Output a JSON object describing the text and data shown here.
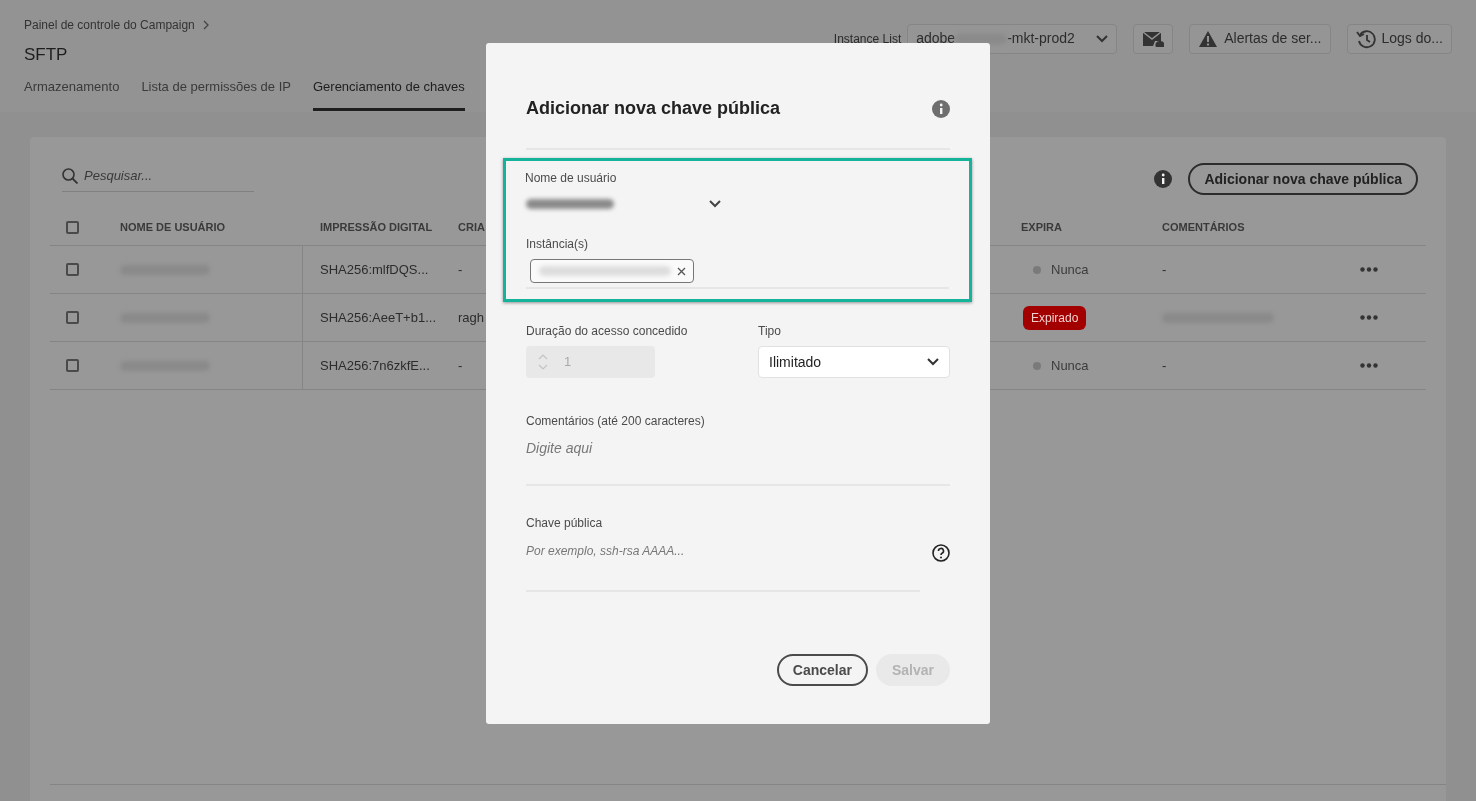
{
  "breadcrumb": "Painel de controle do Campaign",
  "page_title": "SFTP",
  "tabs": [
    {
      "label": "Armazenamento",
      "selected": false
    },
    {
      "label": "Lista de permissões de IP",
      "selected": false
    },
    {
      "label": "Gerenciamento de chaves",
      "selected": true
    }
  ],
  "toolbar": {
    "instance_label": "Instance List",
    "instance_value_start": "adobe",
    "instance_value_end": "-mkt-prod2",
    "alerts_button": "Alertas de ser...",
    "logs_button": "Logs do..."
  },
  "search": {
    "placeholder": "Pesquisar..."
  },
  "add_button": "Adicionar nova chave pública",
  "table": {
    "select_all_checked": false,
    "columns": [
      "NOME DE USUÁRIO",
      "IMPRESSÃO DIGITAL",
      "CRIA",
      "EXPIRA",
      "COMENTÁRIOS"
    ],
    "rows": [
      {
        "checked": false,
        "fingerprint": "SHA256:mlfDQS...",
        "created_by": "-",
        "expires": {
          "kind": "never",
          "text": "Nunca"
        },
        "comment": "-",
        "comment_redacted": false
      },
      {
        "checked": false,
        "fingerprint": "SHA256:AeeT+b1...",
        "created_by": "ragh",
        "expires": {
          "kind": "expired",
          "text": "Expirado"
        },
        "comment_redacted": true
      },
      {
        "checked": false,
        "fingerprint": "SHA256:7n6zkfE...",
        "created_by": "-",
        "expires": {
          "kind": "never",
          "text": "Nunca"
        },
        "comment": "-",
        "comment_redacted": false
      }
    ]
  },
  "modal": {
    "title": "Adicionar nova chave pública",
    "username_label": "Nome de usuário",
    "instances_label": "Instância(s)",
    "duration_label": "Duração do acesso concedido",
    "duration_value": "1",
    "duration_disabled": true,
    "type_label": "Tipo",
    "type_value": "Ilimitado",
    "comments_label": "Comentários (até 200 caracteres)",
    "comments_placeholder": "Digite aqui",
    "key_label": "Chave pública",
    "key_placeholder": "Por exemplo, ssh-rsa AAAA...",
    "cancel_button": "Cancelar",
    "save_button": "Salvar",
    "save_disabled": true
  }
}
